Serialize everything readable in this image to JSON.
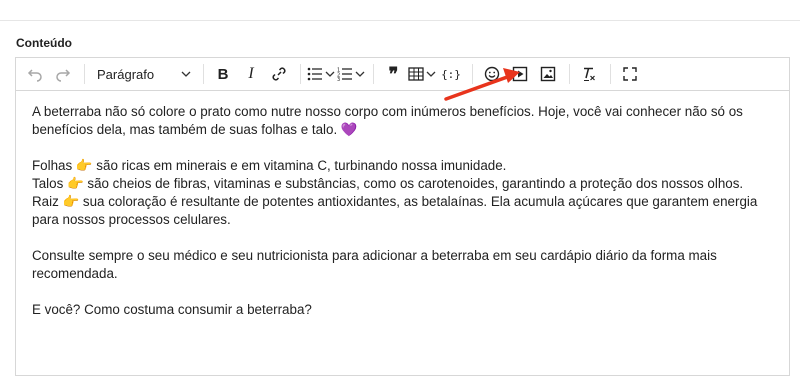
{
  "field": {
    "label": "Conteúdo"
  },
  "toolbar": {
    "format_select": "Parágrafo",
    "bold": "B",
    "italic": "I",
    "quote": "❞",
    "code": "{:}",
    "clear_format": "T",
    "icons": [
      "undo-icon",
      "redo-icon",
      "link-icon",
      "bullet-list-icon",
      "numbered-list-icon",
      "table-icon",
      "emoji-icon",
      "video-icon",
      "image-icon",
      "clear-format-icon",
      "fullscreen-icon"
    ]
  },
  "content": {
    "paragraphs": [
      "A beterraba não só colore o prato como nutre nosso corpo com inúmeros benefícios. Hoje, você vai conhecer não só os benefícios dela, mas também de suas folhas e talo. 💜",
      "",
      "Folhas 👉 são ricas em minerais e em vitamina C, turbinando nossa imunidade.",
      "Talos 👉 são cheios de fibras, vitaminas e substâncias, como os carotenoides, garantindo a proteção dos nossos olhos.",
      "Raiz 👉 sua coloração é resultante de potentes antioxidantes, as betalaínas. Ela acumula açúcares que garantem energia para nossos processos celulares.",
      "",
      "Consulte sempre o seu médico e seu nutricionista para adicionar a beterraba em seu cardápio diário da forma mais recomendada.",
      "",
      "E você? Como costuma consumir a beterraba?"
    ]
  },
  "colors": {
    "arrow": "#e8341c",
    "border": "#d7d7d7"
  }
}
